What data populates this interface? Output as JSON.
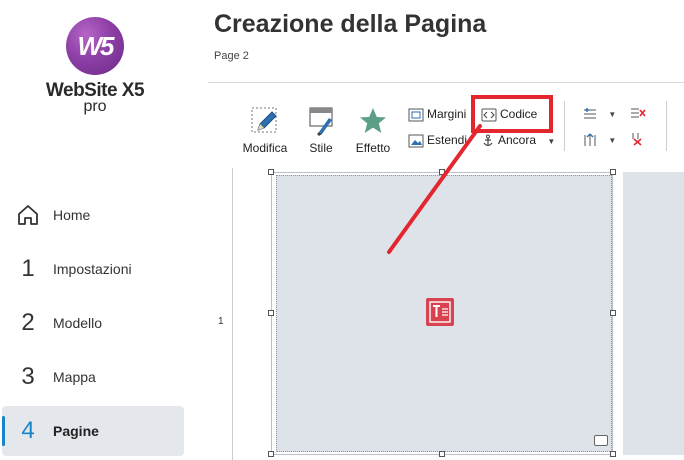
{
  "app": {
    "logo_mark": "W5",
    "logo_name": "WebSite X5",
    "logo_edition": "pro"
  },
  "sidebar": {
    "items": [
      {
        "icon": "home-icon",
        "number": "",
        "label": "Home",
        "active": false
      },
      {
        "icon": "",
        "number": "1",
        "label": "Impostazioni",
        "active": false
      },
      {
        "icon": "",
        "number": "2",
        "label": "Modello",
        "active": false
      },
      {
        "icon": "",
        "number": "3",
        "label": "Mappa",
        "active": false
      },
      {
        "icon": "",
        "number": "4",
        "label": "Pagine",
        "active": true
      }
    ]
  },
  "header": {
    "title": "Creazione della Pagina",
    "subtitle": "Page 2"
  },
  "toolbar": {
    "modifica": "Modifica",
    "stile": "Stile",
    "effetto": "Effetto",
    "margini": "Margini",
    "estendi": "Estendi",
    "codice": "Codice",
    "ancora": "Ancora"
  },
  "canvas": {
    "row_number": "1"
  },
  "colors": {
    "accent": "#1a84c8",
    "highlight": "#e4262e",
    "cell_bg": "#dee3ea",
    "logo": "#8d3fa6"
  }
}
